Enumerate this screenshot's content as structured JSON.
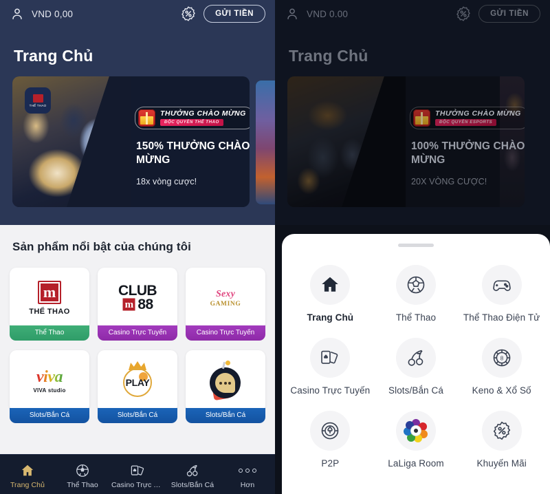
{
  "left_panel": {
    "header": {
      "account_icon": "person-icon",
      "balance": "VND 0,00",
      "promo_icon": "percent-badge-icon",
      "deposit_label": "GỬI TIỀN"
    },
    "page_title": "Trang Chủ",
    "banner": {
      "welcome_chip_main": "THƯỞNG CHÀO MỪNG",
      "welcome_chip_sub": "ĐỘC QUYỀN THỂ THAO",
      "headline": "150% THƯỞNG CHÀO MỪNG",
      "subline": "18x vòng cược!",
      "app_chip_label": "THỂ THAO",
      "gift_icon": "gift-box-icon"
    },
    "section_title": "Sản phẩm nổi bật của chúng tôi",
    "products": [
      {
        "logo": "m88-the-thao-logo",
        "logo_text": "THỂ THAO",
        "badge": "Thể Thao",
        "badge_color": "#2f9c68"
      },
      {
        "logo": "club88-logo",
        "logo_text": "CLUB m88",
        "badge": "Casino Trực Tuyến",
        "badge_color": "#8e2aa8"
      },
      {
        "logo": "sexy-gaming-logo",
        "logo_text": "Sexy Gaming",
        "badge": "Casino Trực Tuyến",
        "badge_color": "#8e2aa8"
      },
      {
        "logo": "viva-studio-logo",
        "logo_text": "VIVA studio",
        "badge": "Slots/Bắn Cá",
        "badge_color": "#1352a0"
      },
      {
        "logo": "play-logo",
        "logo_text": "PLAY",
        "badge": "Slots/Bắn Cá",
        "badge_color": "#1352a0"
      },
      {
        "logo": "bomb-chat-logo",
        "logo_text": "",
        "badge": "Slots/Bắn Cá",
        "badge_color": "#1352a0"
      }
    ],
    "bottom_nav": [
      {
        "label": "Trang Chủ",
        "icon": "home-icon",
        "active": true
      },
      {
        "label": "Thể Thao",
        "icon": "soccer-ball-icon",
        "active": false
      },
      {
        "label": "Casino Trực T…",
        "icon": "cards-icon",
        "active": false
      },
      {
        "label": "Slots/Bắn Cá",
        "icon": "cherry-icon",
        "active": false
      },
      {
        "label": "Hơn",
        "icon": "more-dots-icon",
        "active": false
      }
    ],
    "active_nav_color": "#d8b870"
  },
  "right_panel": {
    "header": {
      "account_icon": "person-icon",
      "balance": "VND 0.00",
      "promo_icon": "percent-badge-icon",
      "deposit_label": "GỬI TIỀN"
    },
    "page_title": "Trang Chủ",
    "banner": {
      "welcome_chip_main": "THƯỞNG CHÀO MỪNG",
      "welcome_chip_sub": "ĐỘC QUYỀN ESPORTS",
      "headline": "100% THƯỞNG CHÀO MỪNG",
      "subline": "20X VÒNG CƯỢC!",
      "gift_icon": "gift-box-icon"
    },
    "sheet": {
      "grabber": "drag-handle",
      "menu": [
        {
          "label": "Trang Chủ",
          "icon": "home-icon",
          "active": true
        },
        {
          "label": "Thể Thao",
          "icon": "soccer-ball-icon",
          "active": false
        },
        {
          "label": "Thể Thao Điện Tử",
          "icon": "gamepad-icon",
          "active": false
        },
        {
          "label": "Casino Trực Tuyến",
          "icon": "cards-icon",
          "active": false
        },
        {
          "label": "Slots/Bắn Cá",
          "icon": "cherry-icon",
          "active": false
        },
        {
          "label": "Keno & Xổ Số",
          "icon": "lottery-chip-icon",
          "active": false
        },
        {
          "label": "P2P",
          "icon": "p2p-icon",
          "active": false
        },
        {
          "label": "LaLiga Room",
          "icon": "laliga-icon",
          "active": false
        },
        {
          "label": "Khuyến Mãi",
          "icon": "percent-badge-icon",
          "active": false
        }
      ]
    }
  },
  "theme": {
    "header_navy": "#2b3756",
    "page_bg": "#f2f2f4",
    "nav_bg": "#141c2e",
    "dim_bg": "#0d111a"
  }
}
